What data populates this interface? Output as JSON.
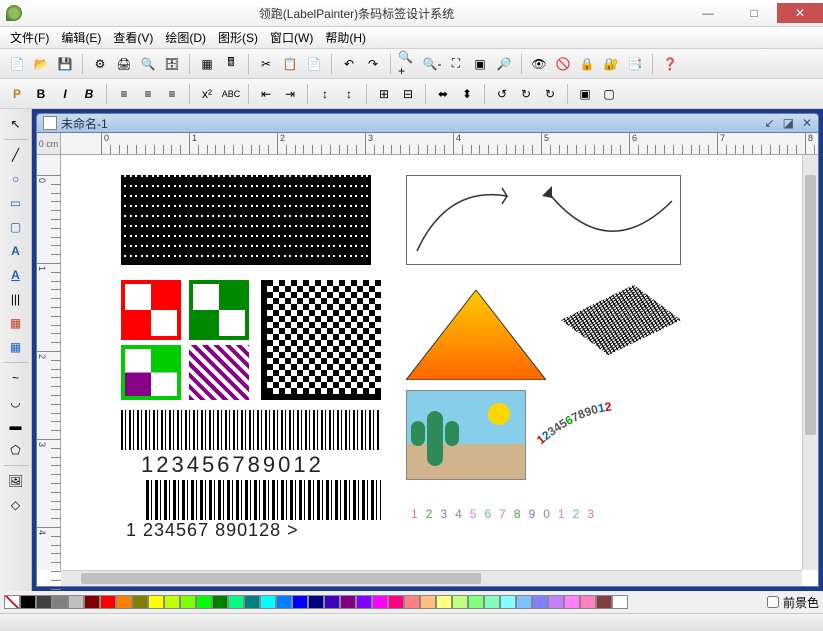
{
  "window": {
    "title": "领跑(LabelPainter)条码标签设计系统",
    "minimize": "—",
    "maximize": "□",
    "close": "✕"
  },
  "menu": {
    "file": "文件(F)",
    "edit": "编辑(E)",
    "view": "查看(V)",
    "draw": "绘图(D)",
    "shape": "图形(S)",
    "window": "窗口(W)",
    "help": "帮助(H)"
  },
  "document": {
    "name": "未命名-1",
    "ruler_unit": "0 cm"
  },
  "ruler": {
    "h_ticks": [
      "0",
      "1",
      "2",
      "3",
      "4",
      "5",
      "6",
      "7",
      "8"
    ],
    "v_ticks": [
      "0",
      "1",
      "2",
      "3",
      "4"
    ]
  },
  "canvas": {
    "barcode1_text": "123456789012",
    "barcode2_text": "1  234567  890128  >",
    "arc_text": "1234567890",
    "rainbow_text": "1234567890123"
  },
  "color_swatches": [
    "#000000",
    "#404040",
    "#808080",
    "#c0c0c0",
    "#800000",
    "#ff0000",
    "#ff8000",
    "#808000",
    "#ffff00",
    "#c0ff00",
    "#80ff00",
    "#00ff00",
    "#008000",
    "#00ff80",
    "#008080",
    "#00ffff",
    "#0080ff",
    "#0000ff",
    "#000080",
    "#4000c0",
    "#800080",
    "#8000ff",
    "#ff00ff",
    "#ff0080",
    "#ff8080",
    "#ffc080",
    "#ffff80",
    "#c0ff80",
    "#80ff80",
    "#80ffc0",
    "#80ffff",
    "#80c0ff",
    "#8080ff",
    "#c080ff",
    "#ff80ff",
    "#ff80c0",
    "#804040",
    "#ffffff"
  ],
  "foreground": {
    "label": "前景色"
  },
  "toolbar_icons": {
    "new": "📄",
    "open": "📂",
    "save": "💾",
    "settings": "⚙",
    "print": "🖨",
    "preview": "🔍",
    "db": "🗄",
    "grid": "▦",
    "calc": "🖩",
    "cut": "✂",
    "copy": "📋",
    "paste": "📄",
    "undo": "↶",
    "redo": "↷",
    "zoomin": "🔍+",
    "zoomout": "🔍-",
    "fit": "⛶",
    "fitpage": "▣",
    "zoom100": "🔎",
    "eye": "👁",
    "eyeoff": "🚫",
    "lock": "🔒",
    "lockall": "🔐",
    "props": "📑",
    "help": "❓"
  },
  "toolbar2_icons": {
    "plain": "P",
    "bold": "B",
    "italic": "I",
    "boldB": "B",
    "alignl": "≡",
    "alignc": "≡",
    "alignr": "≡",
    "supsub": "x²",
    "abc": "ABC",
    "indentl": "⇤",
    "indentr": "⇥",
    "spaceu": "↕",
    "spaced": "↕",
    "merge": "⊞",
    "dmerge": "⊟",
    "alignh": "⬌",
    "alignv": "⬍",
    "rot90l": "↺",
    "rot180": "↻",
    "rot90r": "↻",
    "group": "▣",
    "ungroup": "▢"
  },
  "sidetools": {
    "pointer": "↖",
    "line": "╱",
    "ellipse": "○",
    "rect": "▭",
    "roundrect": "▢",
    "text": "A",
    "vtext": "A",
    "barcode": "|||",
    "qr": "▦",
    "table": "▦",
    "curve": "~",
    "arc": "◡",
    "polyrect": "▬",
    "polygon": "⬠",
    "image": "🖼",
    "shape": "◇"
  }
}
